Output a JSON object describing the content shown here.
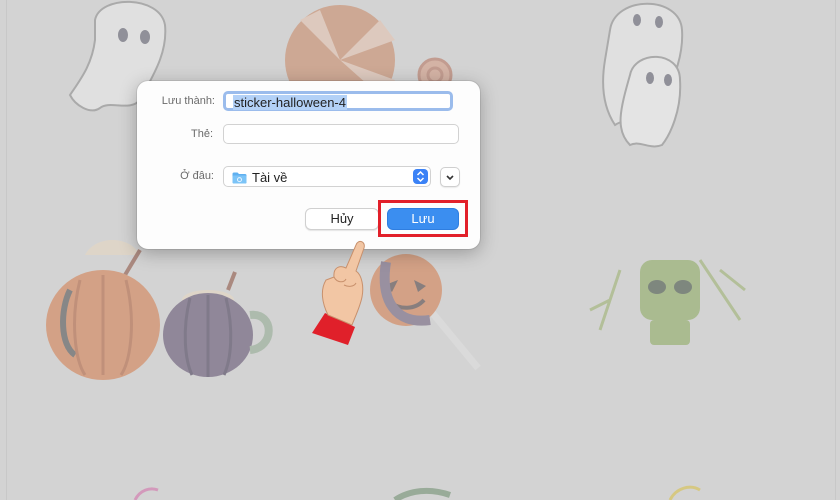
{
  "save_dialog": {
    "save_as_label": "Lưu thành:",
    "filename_value": "sticker-halloween-4",
    "tags_label": "Thẻ:",
    "tags_value": "",
    "where_label": "Ở đâu:",
    "location_value": "Tài về",
    "cancel_label": "Hủy",
    "save_label": "Lưu"
  },
  "icons": {
    "folder": "folder-icon",
    "stepper": "up-down-chevron-icon",
    "expand": "chevron-down-icon",
    "hand": "pointing-hand-icon"
  },
  "colors": {
    "accent": "#3b8ef0",
    "highlight": "#e2202a",
    "overlay": "#d3d3d3"
  }
}
